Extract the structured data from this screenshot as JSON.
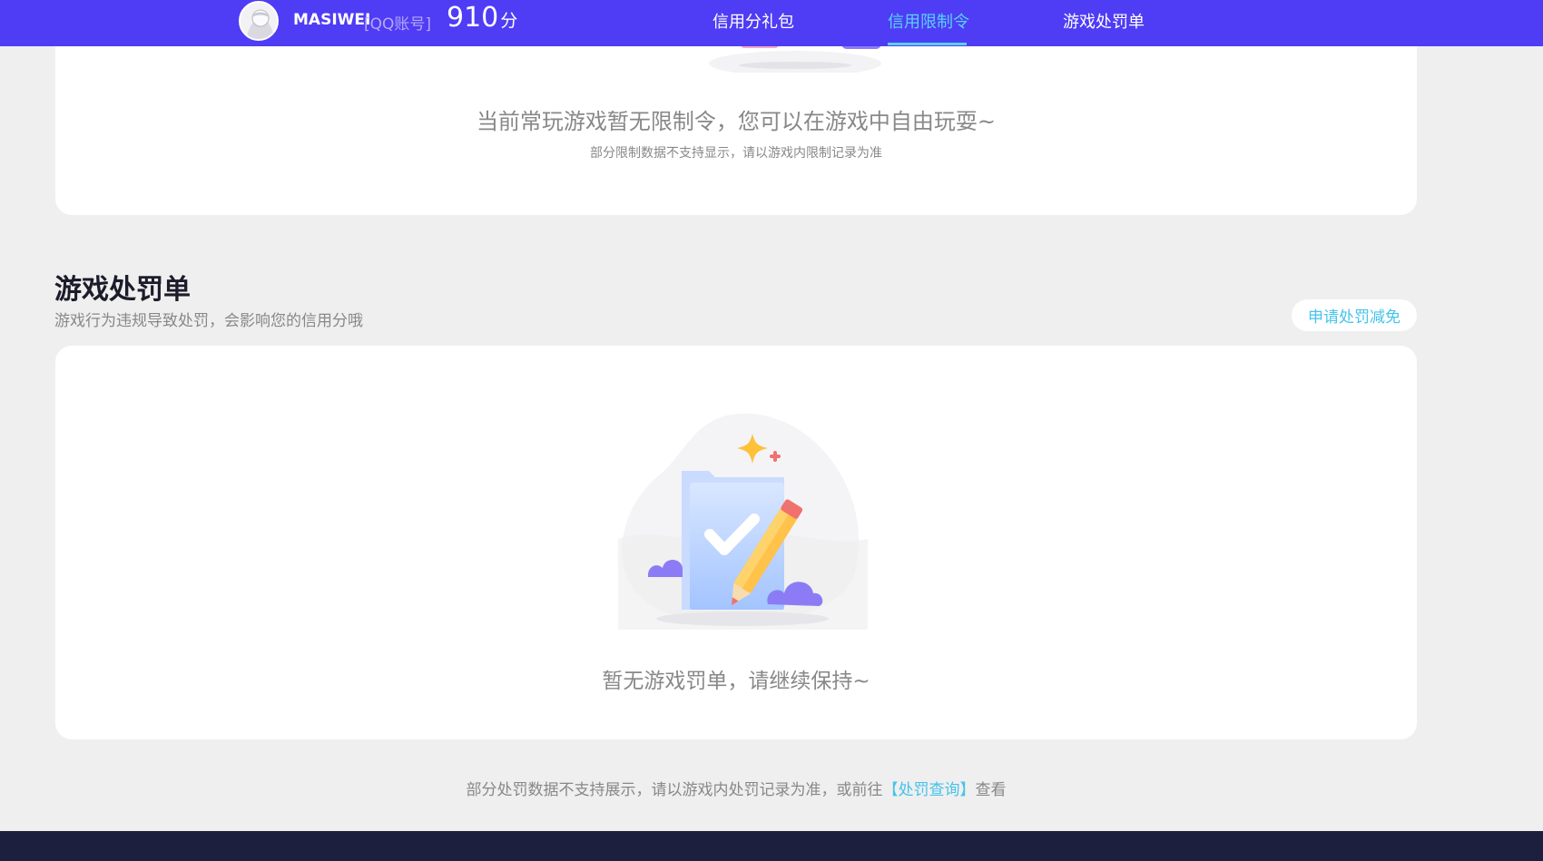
{
  "header": {
    "username": "MASIWEI",
    "account_type": "[QQ账号]",
    "score": "910",
    "score_unit": "分",
    "nav": [
      {
        "label": "信用分礼包"
      },
      {
        "label": "信用限制令"
      },
      {
        "label": "游戏处罚单"
      }
    ],
    "active_nav_color": "#59d2f7",
    "bar_color": "#4f3cf5"
  },
  "limit_card": {
    "message": "当前常玩游戏暂无限制令，您可以在游戏中自由玩耍~",
    "note": "部分限制数据不支持显示，请以游戏内限制记录为准"
  },
  "penalty_section": {
    "title": "游戏处罚单",
    "description": "游戏行为违规导致处罚，会影响您的信用分哦",
    "apply_button": "申请处罚减免",
    "empty_message": "暂无游戏罚单，请继续保持~"
  },
  "bottom_note": {
    "text_before": "部分处罚数据不支持展示，请以游戏内处罚记录为准，或前往",
    "link_text": "【处罚查询】",
    "text_after": "查看"
  },
  "icons": {
    "avatar": "user-avatar",
    "empty_state": "checklist-pencil-illustration"
  }
}
